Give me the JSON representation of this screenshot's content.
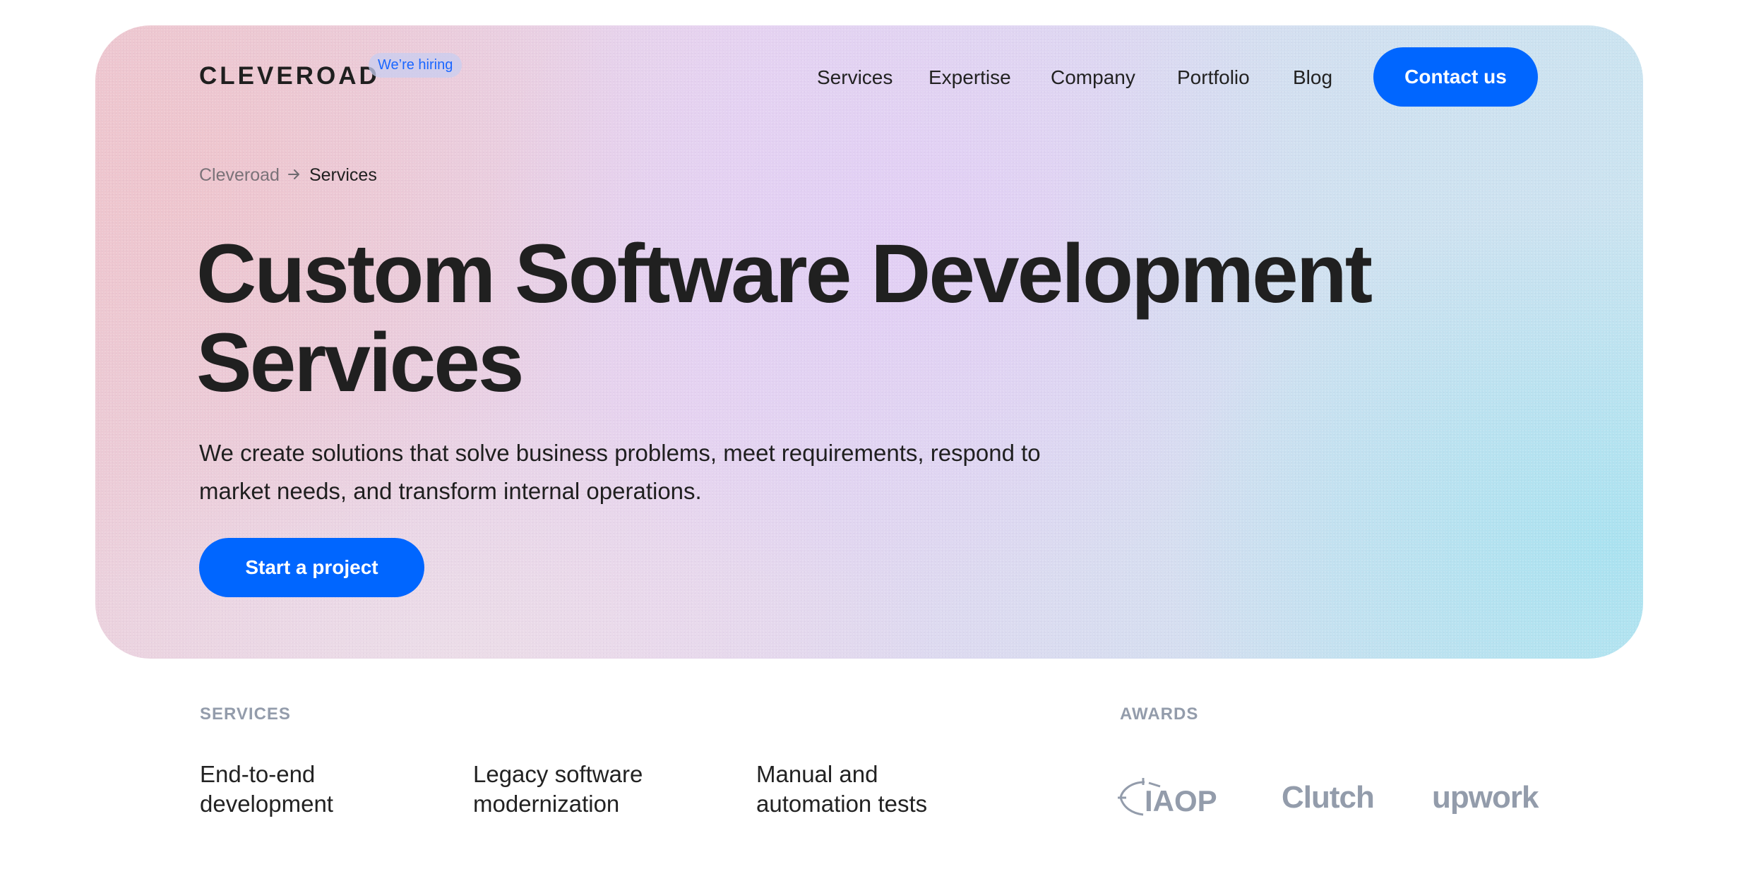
{
  "header": {
    "logo": "CLEVEROAD",
    "hiring_badge": "We’re hiring",
    "nav": [
      {
        "label": "Services"
      },
      {
        "label": "Expertise"
      },
      {
        "label": "Company"
      },
      {
        "label": "Portfolio"
      },
      {
        "label": "Blog"
      }
    ],
    "contact_button": "Contact us"
  },
  "breadcrumb": {
    "home": "Cleveroad",
    "separator_icon": "arrow-right-icon",
    "current": "Services"
  },
  "hero": {
    "title_line1": "Custom Software Development",
    "title_line2": "Services",
    "subtitle_line1": "We create solutions that solve business problems, meet requirements, respond to",
    "subtitle_line2": "market needs, and transform internal operations.",
    "cta_button": "Start a project"
  },
  "services": {
    "label": "SERVICES",
    "items": [
      {
        "line1": "End-to-end",
        "line2": "development"
      },
      {
        "line1": "Legacy software",
        "line2": "modernization"
      },
      {
        "line1": "Manual and",
        "line2": "automation tests"
      }
    ]
  },
  "awards": {
    "label": "AWARDS",
    "logos": [
      {
        "name": "IAOP",
        "icon": "iaop-logo"
      },
      {
        "name": "Clutch",
        "icon": "clutch-logo"
      },
      {
        "name": "Upwork",
        "icon": "upwork-logo"
      }
    ]
  },
  "colors": {
    "accent": "#0066FF",
    "text": "#222222",
    "muted": "#939CAB",
    "badge_bg": "#CDD0F0"
  }
}
